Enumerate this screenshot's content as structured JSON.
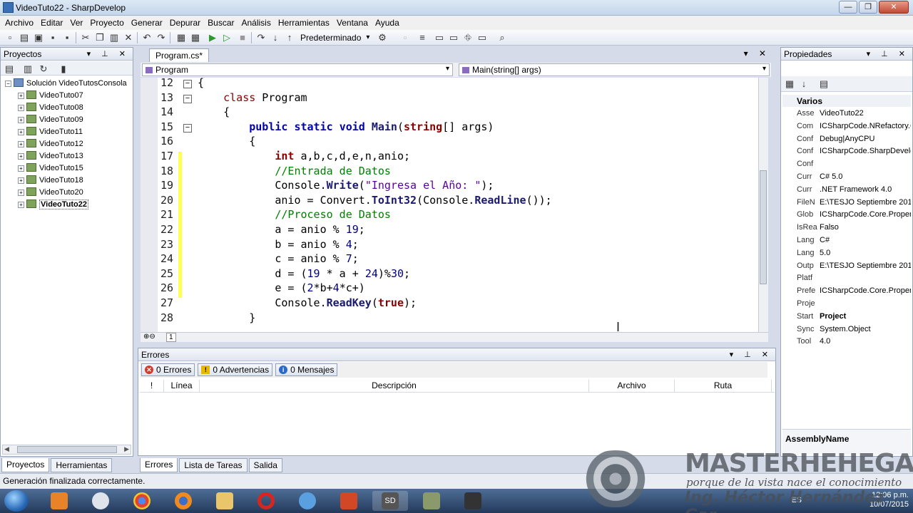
{
  "window": {
    "title": "VideoTuto22 - SharpDevelop",
    "buttons": [
      "—",
      "❐",
      "✕"
    ]
  },
  "menu": [
    "Archivo",
    "Editar",
    "Ver",
    "Proyecto",
    "Generar",
    "Depurar",
    "Buscar",
    "Análisis",
    "Herramientas",
    "Ventana",
    "Ayuda"
  ],
  "toolbar": {
    "config": "Predeterminado"
  },
  "projects": {
    "title": "Proyectos",
    "solution": "Solución VideoTutosConsola",
    "items": [
      "VideoTuto07",
      "VideoTuto08",
      "VideoTuto09",
      "VideoTuto11",
      "VideoTuto12",
      "VideoTuto13",
      "VideoTuto15",
      "VideoTuto18",
      "VideoTuto20",
      "VideoTuto22"
    ],
    "selected": "VideoTuto22",
    "tabs": [
      "Proyectos",
      "Herramientas"
    ]
  },
  "editor": {
    "tab": "Program.cs*",
    "class_combo": "Program",
    "member_combo": "Main(string[] args)",
    "lines": [
      {
        "n": "12",
        "fold": "-",
        "code": "{"
      },
      {
        "n": "13",
        "fold": "-",
        "code": "    class Program"
      },
      {
        "n": "14",
        "fold": "",
        "code": "    {"
      },
      {
        "n": "15",
        "fold": "-",
        "code": "        public static void Main(string[] args)"
      },
      {
        "n": "16",
        "fold": "",
        "code": "        {"
      },
      {
        "n": "17",
        "fold": "",
        "code": "            int a,b,c,d,e,n,anio;"
      },
      {
        "n": "18",
        "fold": "",
        "code": "            //Entrada de Datos"
      },
      {
        "n": "19",
        "fold": "",
        "code": "            Console.Write(\"Ingresa el Año: \");"
      },
      {
        "n": "20",
        "fold": "",
        "code": "            anio = Convert.ToInt32(Console.ReadLine());"
      },
      {
        "n": "21",
        "fold": "",
        "code": "            //Proceso de Datos"
      },
      {
        "n": "22",
        "fold": "",
        "code": "            a = anio % 19;"
      },
      {
        "n": "23",
        "fold": "",
        "code": "            b = anio % 4;"
      },
      {
        "n": "24",
        "fold": "",
        "code": "            c = anio % 7;"
      },
      {
        "n": "25",
        "fold": "",
        "code": "            d = (19 * a + 24)%30;"
      },
      {
        "n": "26",
        "fold": "",
        "code": "            e = (2*b+4*c+)"
      },
      {
        "n": "27",
        "fold": "",
        "code": "            Console.ReadKey(true);"
      },
      {
        "n": "28",
        "fold": "",
        "code": "        }"
      }
    ],
    "zoom_label": "1"
  },
  "errors": {
    "title": "Errores",
    "buttons": [
      "0 Errores",
      "0 Advertencias",
      "0 Mensajes"
    ],
    "columns": [
      "!",
      "Línea",
      "Descripción",
      "Archivo",
      "Ruta"
    ],
    "tabs": [
      "Errores",
      "Lista de Tareas",
      "Salida"
    ]
  },
  "properties": {
    "title": "Propiedades",
    "category": "Varios",
    "rows": [
      {
        "name": "Asse",
        "value": "VideoTuto22"
      },
      {
        "name": "Com",
        "value": "ICSharpCode.NRefactory.C"
      },
      {
        "name": "Conf",
        "value": "Debug|AnyCPU"
      },
      {
        "name": "Conf",
        "value": "ICSharpCode.SharpDevelop"
      },
      {
        "name": "Conf",
        "value": ""
      },
      {
        "name": "Curr",
        "value": "C# 5.0"
      },
      {
        "name": "Curr",
        "value": ".NET Framework 4.0"
      },
      {
        "name": "FileN",
        "value": "E:\\TESJO Septiembre 2015 -"
      },
      {
        "name": "Glob",
        "value": "ICSharpCode.Core.Properti"
      },
      {
        "name": "IsRea",
        "value": "Falso"
      },
      {
        "name": "Lang",
        "value": "C#"
      },
      {
        "name": "Lang",
        "value": "5.0"
      },
      {
        "name": "Outp",
        "value": "E:\\TESJO Septiembre 2015 -"
      },
      {
        "name": "Platf",
        "value": ""
      },
      {
        "name": "Prefe",
        "value": "ICSharpCode.Core.Properti"
      },
      {
        "name": "Proje",
        "value": ""
      },
      {
        "name": "Start",
        "value": "Project"
      },
      {
        "name": "Sync",
        "value": "System.Object"
      },
      {
        "name": "Tool",
        "value": "4.0"
      }
    ],
    "description_title": "AssemblyName"
  },
  "status": "Generación finalizada correctamente.",
  "tray": {
    "lang": "ES",
    "time": "12:06 p.m.",
    "date": "10/07/2015"
  },
  "watermark": {
    "title": "MASTERHEHEGAR",
    "subtitle": "porque de la vista nace el conocimiento",
    "name": "Ing. Héctor Hernández Gar..."
  },
  "colors": {
    "accent": "#3a6fb5",
    "change_bar": "#ffff50",
    "keyword": "#0000b0",
    "comment": "#008000"
  }
}
